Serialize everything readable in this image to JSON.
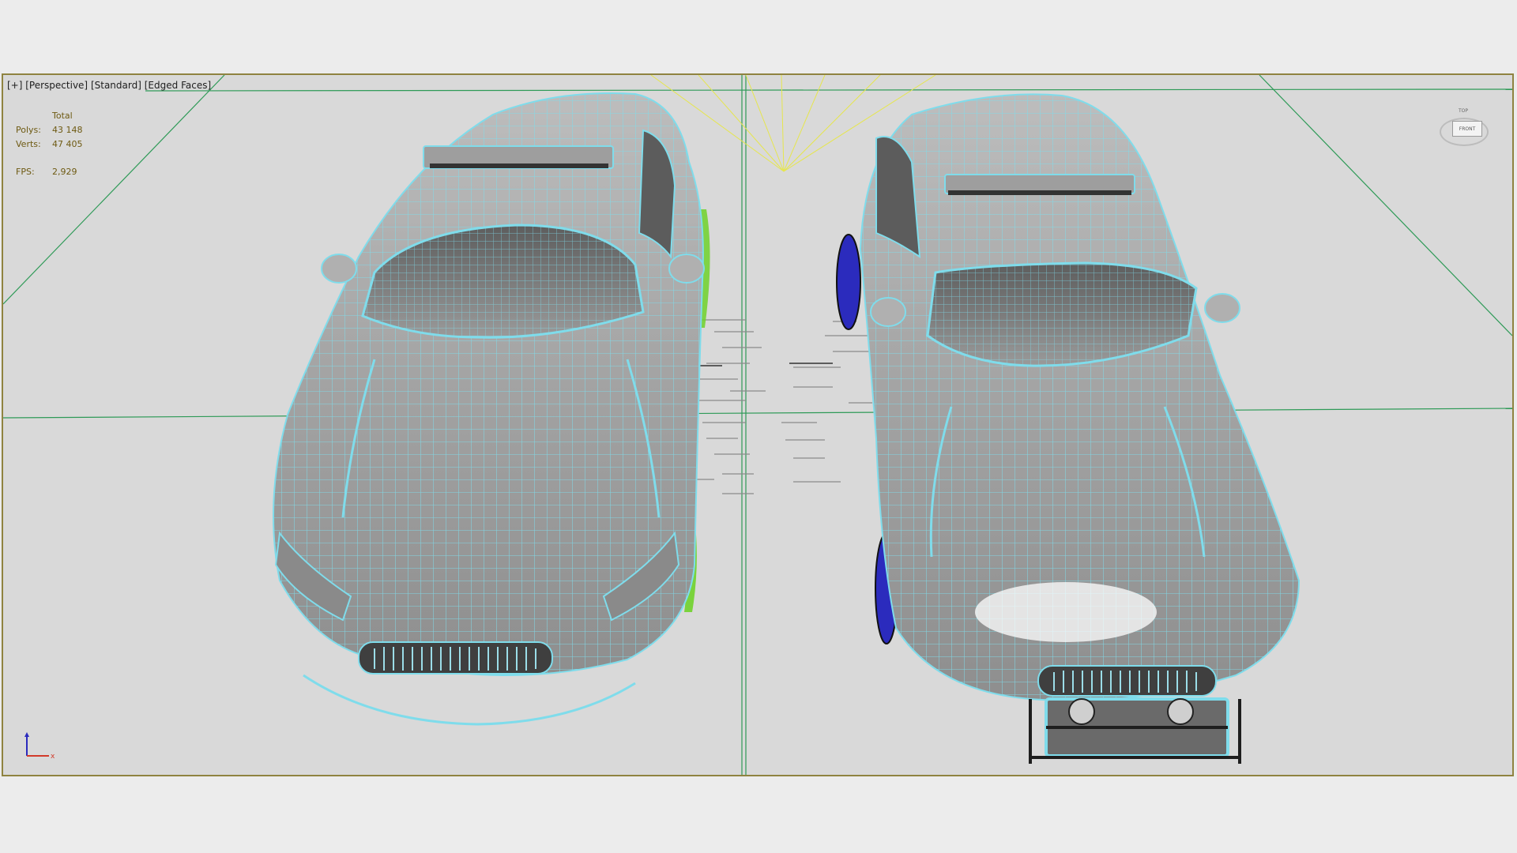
{
  "viewport": {
    "labels": [
      "[+]",
      "[Perspective]",
      "[Standard]",
      "[Edged Faces]"
    ],
    "stats": {
      "header": "Total",
      "polys_label": "Polys:",
      "polys_value": "43 148",
      "verts_label": "Verts:",
      "verts_value": "47 405",
      "fps_label": "FPS:",
      "fps_value": "2,929"
    },
    "viewcube": {
      "top_label": "TOP",
      "front_label": "FRONT"
    },
    "axis": {
      "x_label": "x"
    }
  },
  "colors": {
    "wire": "#7fdceb",
    "body": "#a8a8a8",
    "grid": "#2e9a57",
    "light_rays": "#e6e64e",
    "left_wheel_accent": "#6fd12a",
    "right_wheel_accent": "#2b2bbd",
    "frame": "#8f8340",
    "stats_text": "#6e5a12"
  }
}
